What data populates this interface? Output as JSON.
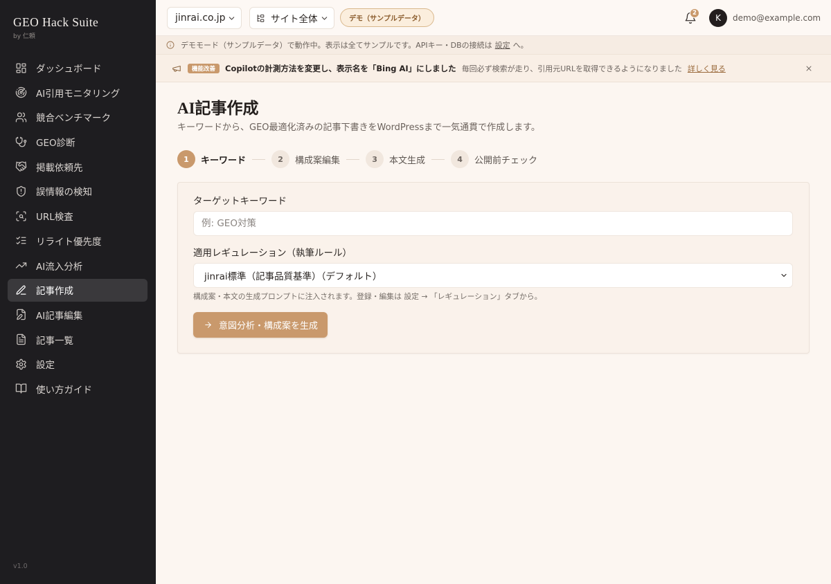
{
  "theme": {
    "accent": "#c9996c",
    "sidebar_bg": "#1e1d20",
    "sidebar_active_bg": "#3a393c",
    "page_bg": "#fcf6f1"
  },
  "app": {
    "title": "GEO Hack Suite",
    "byline": "by 仁頼",
    "version": "v1.0"
  },
  "sidebar": {
    "items": [
      {
        "label": "ダッシュボード",
        "icon": "layout-dashboard-icon",
        "active": false
      },
      {
        "label": "AI引用モニタリング",
        "icon": "radar-icon",
        "active": false
      },
      {
        "label": "競合ベンチマーク",
        "icon": "users-icon",
        "active": false
      },
      {
        "label": "GEO診断",
        "icon": "stethoscope-icon",
        "active": false
      },
      {
        "label": "掲載依頼先",
        "icon": "handshake-icon",
        "active": false
      },
      {
        "label": "誤情報の検知",
        "icon": "shield-alert-icon",
        "active": false
      },
      {
        "label": "URL検査",
        "icon": "scan-search-icon",
        "active": false
      },
      {
        "label": "リライト優先度",
        "icon": "list-checks-icon",
        "active": false
      },
      {
        "label": "AI流入分析",
        "icon": "trending-up-icon",
        "active": false
      },
      {
        "label": "記事作成",
        "icon": "pencil-icon",
        "active": true
      },
      {
        "label": "AI記事編集",
        "icon": "file-pen-icon",
        "active": false
      },
      {
        "label": "記事一覧",
        "icon": "file-text-icon",
        "active": false
      },
      {
        "label": "設定",
        "icon": "settings-icon",
        "active": false
      },
      {
        "label": "使い方ガイド",
        "icon": "book-open-icon",
        "active": false
      }
    ]
  },
  "topbar": {
    "domain_select": "jinrai.co.jp",
    "scope_select": "サイト全体",
    "demo_badge": "デモ（サンプルデータ）",
    "notification_count": "2",
    "avatar_initial": "K",
    "user_email": "demo@example.com"
  },
  "demo_notice": {
    "text": "デモモード（サンプルデータ）で動作中。表示は全てサンプルです。APIキー・DBの接続は",
    "link": "設定",
    "suffix": "へ。"
  },
  "announcement": {
    "tag": "機能改善",
    "headline": "Copilotの計測方法を変更し、表示名を「Bing AI」にしました",
    "detail": "毎回必ず検索が走り、引用元URLを取得できるようになりました",
    "link": "詳しく見る"
  },
  "page": {
    "title": "AI記事作成",
    "subtitle": "キーワードから、GEO最適化済みの記事下書きをWordPressまで一気通貫で作成します。"
  },
  "steps": [
    {
      "number": "1",
      "label": "キーワード",
      "current": true
    },
    {
      "number": "2",
      "label": "構成案編集",
      "current": false
    },
    {
      "number": "3",
      "label": "本文生成",
      "current": false
    },
    {
      "number": "4",
      "label": "公開前チェック",
      "current": false
    }
  ],
  "form": {
    "keyword": {
      "label": "ターゲットキーワード",
      "placeholder": "例: GEO対策"
    },
    "regulation": {
      "label": "適用レギュレーション（執筆ルール）",
      "selected": "jinrai標準（記事品質基準）（デフォルト）",
      "help": "構成案・本文の生成プロンプトに注入されます。登録・編集は 設定 → 「レギュレーション」タブから。"
    },
    "submit_label": "意図分析・構成案を生成"
  }
}
